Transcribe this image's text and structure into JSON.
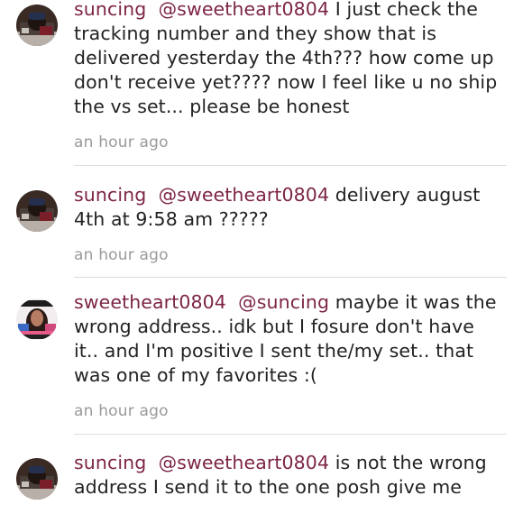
{
  "comments": [
    {
      "username": "suncing",
      "mention": "@sweetheart0804",
      "text": "I just check the tracking number and they show that is delivered yesterday the 4th??? how come up don't receive yet???? now I feel like u no ship the vs set... please be honest",
      "time": "an hour ago",
      "avatar": "suncing-avatar"
    },
    {
      "username": "suncing",
      "mention": "@sweetheart0804",
      "text": "delivery august 4th at 9:58 am ?????",
      "time": "an hour ago",
      "avatar": "suncing-avatar"
    },
    {
      "username": "sweetheart0804",
      "mention": "@suncing",
      "text": "maybe it was the wrong address.. idk but I fosure don't have it.. and I'm positive I sent the/my set.. that was one of my favorites :(",
      "time": "an hour ago",
      "avatar": "sweetheart0804-avatar"
    },
    {
      "username": "suncing",
      "mention": "@sweetheart0804",
      "text": "is not the wrong address I send it to the one posh give me",
      "time": "",
      "avatar": "suncing-avatar"
    }
  ],
  "colors": {
    "username": "#7d2547",
    "timestamp": "#9a9a9a",
    "divider": "#dddddd"
  }
}
